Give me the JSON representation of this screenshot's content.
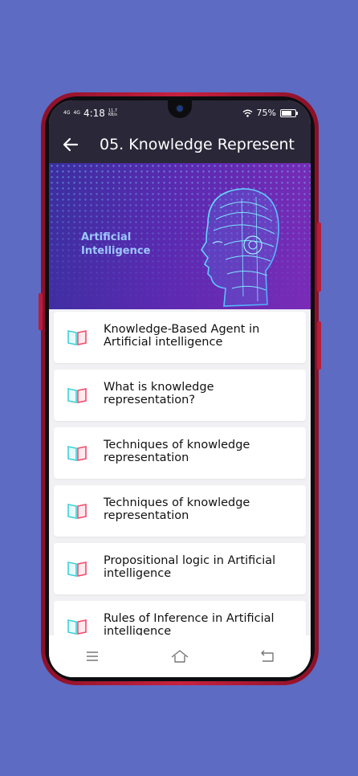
{
  "status_bar": {
    "signal_1": "4G",
    "signal_2": "4G",
    "time": "4:18",
    "net_speed": "11.7 KB/s",
    "battery": "75%"
  },
  "app_bar": {
    "title": "05. Knowledge Represent"
  },
  "banner": {
    "line1": "Artificial",
    "line2": "Intelligence"
  },
  "topics": [
    {
      "title": "Knowledge-Based Agent in Artificial intelligence"
    },
    {
      "title": "What is knowledge representation?"
    },
    {
      "title": "Techniques of knowledge representation"
    },
    {
      "title": "Techniques of knowledge representation"
    },
    {
      "title": "Propositional logic in Artificial intelligence"
    },
    {
      "title": "Rules of Inference in Artificial intelligence"
    }
  ],
  "colors": {
    "background": "#5e6bc2",
    "app_bar": "#2a2738",
    "book_icon_teal": "#3fd0d8",
    "book_icon_red": "#f24b6a"
  },
  "icons": [
    "back-arrow-icon",
    "book-icon",
    "menu-icon",
    "home-icon",
    "return-icon",
    "wifi-icon",
    "battery-icon"
  ]
}
